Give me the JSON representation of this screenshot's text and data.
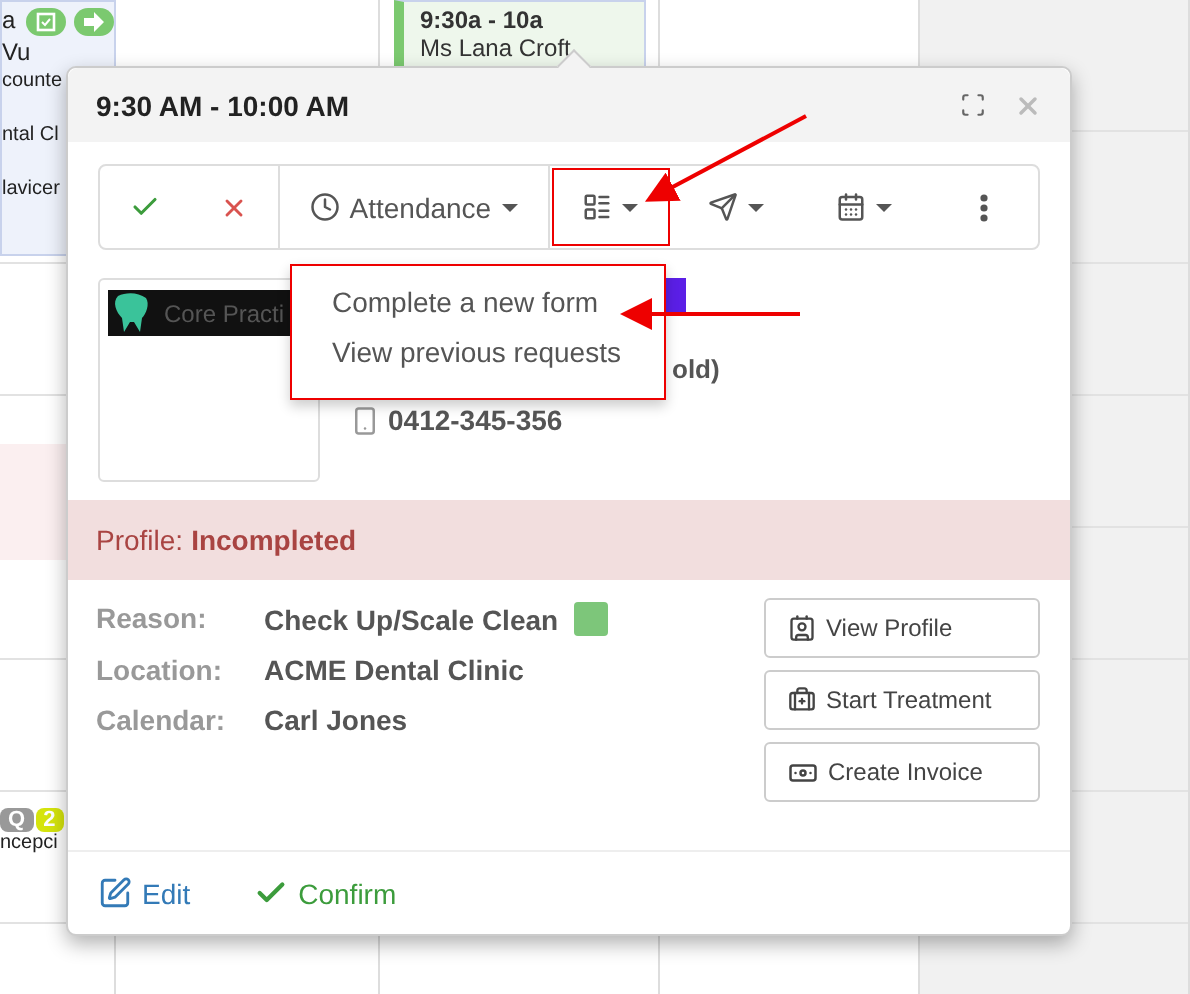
{
  "calendar": {
    "left_event": {
      "lines": [
        "a",
        "Vu",
        "counte",
        "ntal Cl",
        "lavicer"
      ]
    },
    "top_event": {
      "time": "9:30a - 10a",
      "name": "Ms Lana Croft"
    },
    "bottom_event": {
      "badges": [
        "Q",
        "2"
      ],
      "text": "ncepci"
    }
  },
  "popup": {
    "title": "9:30 AM - 10:00 AM",
    "toolbar": [
      {
        "kind": "confirm"
      },
      {
        "kind": "cancel"
      },
      {
        "kind": "attendance",
        "label": "Attendance"
      },
      {
        "kind": "forms",
        "annotated": true
      },
      {
        "kind": "send"
      },
      {
        "kind": "calendar"
      },
      {
        "kind": "more"
      }
    ],
    "menu": {
      "items": [
        "Complete a new form",
        "View previous requests"
      ]
    },
    "logo": {
      "text": "Core Practi"
    },
    "patient": {
      "name_tail": "old)",
      "phone": "0412-345-356"
    },
    "profile": {
      "label": "Profile:",
      "status": "Incompleted"
    },
    "details": [
      {
        "label": "Reason:",
        "value": "Check Up/Scale Clean",
        "color": "#7dc67a"
      },
      {
        "label": "Location:",
        "value": "ACME Dental Clinic"
      },
      {
        "label": "Calendar:",
        "value": "Carl Jones"
      }
    ],
    "actions": [
      {
        "kind": "profile",
        "label": "View Profile"
      },
      {
        "kind": "treatment",
        "label": "Start Treatment"
      },
      {
        "kind": "invoice",
        "label": "Create Invoice"
      }
    ],
    "footer": [
      {
        "kind": "edit",
        "label": "Edit"
      },
      {
        "kind": "confirm",
        "label": "Confirm"
      }
    ]
  }
}
